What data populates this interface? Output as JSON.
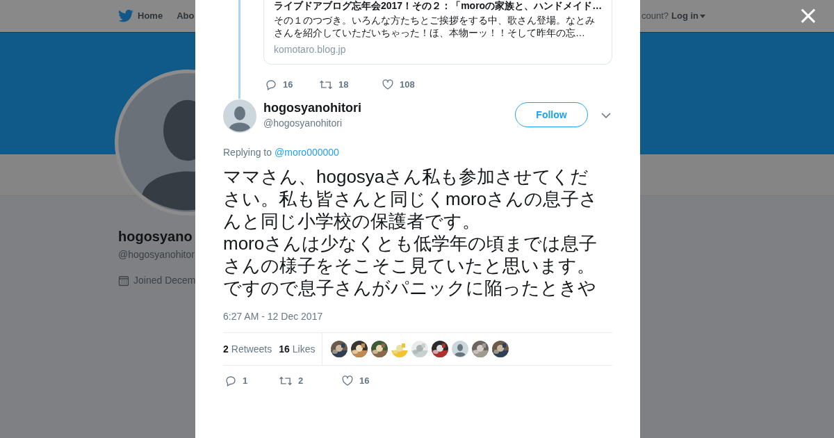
{
  "background_page": {
    "nav": {
      "items": [
        {
          "label": "Home"
        },
        {
          "label": "Abo"
        }
      ],
      "account_prompt": "count?",
      "login": "Log in"
    },
    "profile": {
      "name": "hogosyano",
      "handle": "@hogosyanohitor",
      "joined": "Joined Decem"
    }
  },
  "close_label": "×",
  "thread_parent": {
    "card": {
      "title": "ライブドアブログ忘年会2017！その２：「moroの家族と、ハンドメイド…",
      "description": "その１のつづき。いろんな方たちとご挨拶をする中、歌さん登場。なとみさんを紹介していただいちゃった！ほ、本物ーッ！！そして昨年の忘…",
      "domain": "komotaro.blog.jp"
    },
    "actions": {
      "replies": "16",
      "retweets": "18",
      "likes": "108"
    }
  },
  "tweet": {
    "name": "hogosyanohitori",
    "handle": "@hogosyanohitori",
    "follow_label": "Follow",
    "replying_prefix": "Replying to",
    "replying_to": "@moro000000",
    "text_lines": [
      "ママさん、hogosyaさん私も参加させてください。私も皆さんと同じくmoroさんの息子さんと同じ小学校の保護者です。",
      "moroさんは少なくとも低学年の頃までは息子さんの様子をそこそこ見ていたと思います。",
      "ですので息子さんがパニックに陥ったときや"
    ],
    "timestamp": "6:27 AM - 12 Dec 2017",
    "stats": [
      {
        "count": "2",
        "label": "Retweets"
      },
      {
        "count": "16",
        "label": "Likes"
      }
    ],
    "liker_avatars": [
      {
        "kind": "picture"
      },
      {
        "kind": "picture"
      },
      {
        "kind": "picture"
      },
      {
        "kind": "picture"
      },
      {
        "kind": "picture"
      },
      {
        "kind": "picture"
      },
      {
        "kind": "default"
      },
      {
        "kind": "picture"
      },
      {
        "kind": "picture"
      }
    ],
    "actions": {
      "replies": "1",
      "retweets": "2",
      "likes": "16"
    }
  }
}
